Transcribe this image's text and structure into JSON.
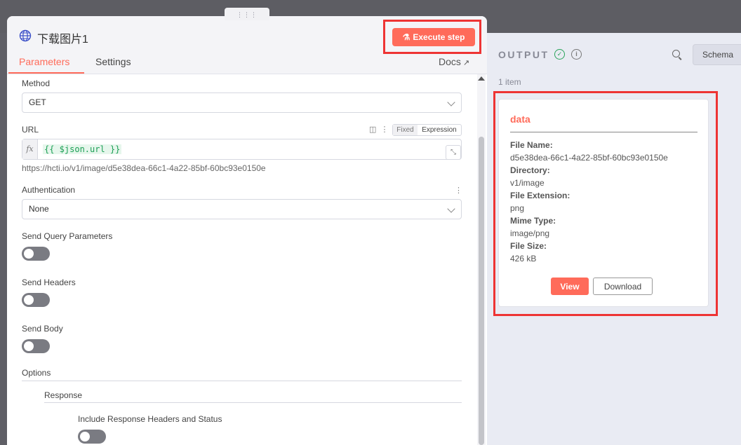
{
  "node": {
    "title": "下载图片1",
    "execute_label": "Execute step",
    "tabs": [
      "Parameters",
      "Settings"
    ],
    "docs_label": "Docs"
  },
  "params": {
    "method_label": "Method",
    "method_value": "GET",
    "url_label": "URL",
    "mode_fixed": "Fixed",
    "mode_expression": "Expression",
    "fx_label": "fx",
    "url_expression": "{{ $json.url }}",
    "url_preview": "https://hcti.io/v1/image/d5e38dea-66c1-4a22-85bf-60bc93e0150e",
    "auth_label": "Authentication",
    "auth_value": "None",
    "send_query_label": "Send Query Parameters",
    "send_query_on": false,
    "send_headers_label": "Send Headers",
    "send_headers_on": false,
    "send_body_label": "Send Body",
    "send_body_on": false,
    "options_label": "Options",
    "response_label": "Response",
    "include_headers_label": "Include Response Headers and Status",
    "include_headers_on": false
  },
  "output": {
    "title": "OUTPUT",
    "schema_label": "Schema",
    "item_count": "1 item",
    "card": {
      "title": "data",
      "fields": [
        {
          "key": "File Name:",
          "value": "d5e38dea-66c1-4a22-85bf-60bc93e0150e"
        },
        {
          "key": "Directory:",
          "value": "v1/image"
        },
        {
          "key": "File Extension:",
          "value": "png"
        },
        {
          "key": "Mime Type:",
          "value": "image/png"
        },
        {
          "key": "File Size:",
          "value": "426 kB"
        }
      ],
      "view_label": "View",
      "download_label": "Download"
    }
  },
  "colors": {
    "accent": "#ff6b5a",
    "highlight": "#ee3434",
    "success": "#29a35a",
    "expression": "#1c9f55"
  }
}
